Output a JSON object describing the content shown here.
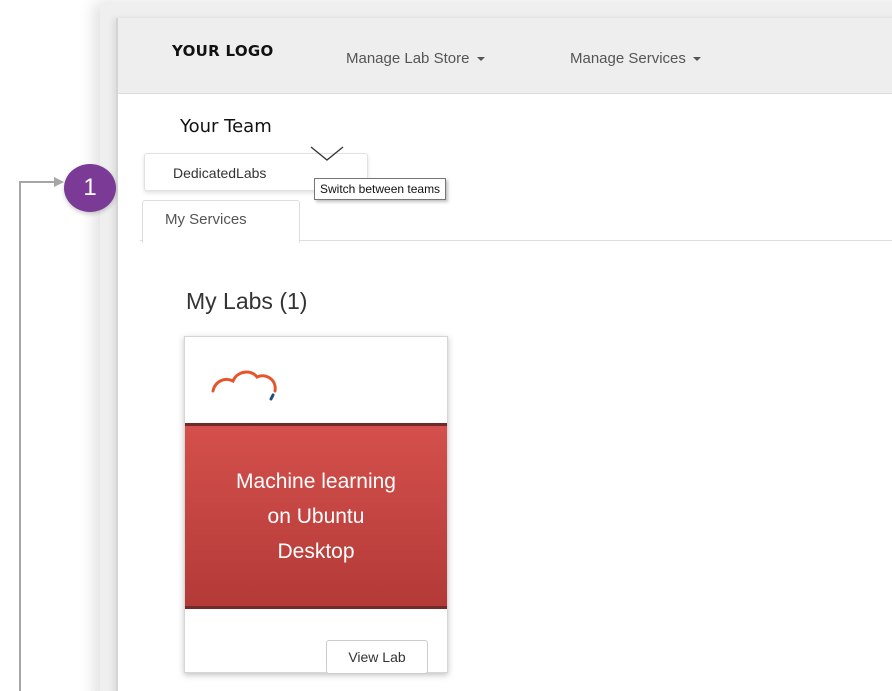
{
  "navbar": {
    "logo": "YOUR LOGO",
    "items": [
      {
        "label": "Manage Lab Store"
      },
      {
        "label": "Manage Services"
      }
    ]
  },
  "team": {
    "heading": "Your Team",
    "current": "DedicatedLabs",
    "tooltip": "Switch between teams"
  },
  "tabs": [
    {
      "label": "My Services"
    }
  ],
  "labs": {
    "heading": "My Labs (1)",
    "items": [
      {
        "title": "Machine learning\non Ubuntu\nDesktop",
        "button": "View Lab",
        "icon": "cloud-icon"
      }
    ]
  },
  "callout": {
    "number": "1",
    "color": "#7a3a96"
  },
  "colors": {
    "lab_banner": "#c94744",
    "cloud_orange": "#e8542a",
    "cloud_blue": "#1a4f86"
  }
}
